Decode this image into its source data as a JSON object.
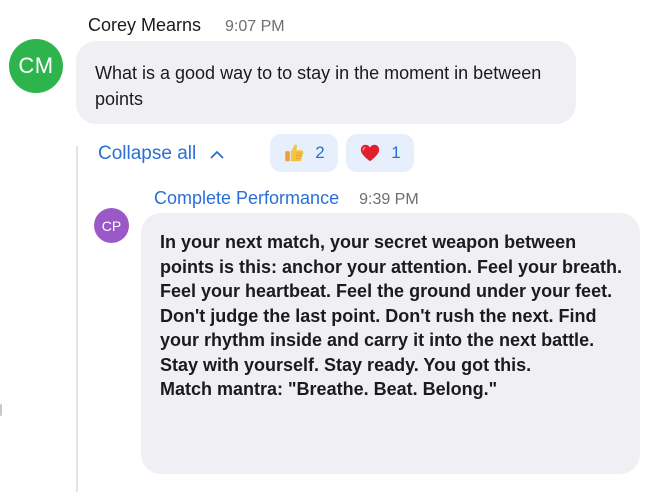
{
  "message": {
    "avatar_initials": "CM",
    "sender": "Corey Mearns",
    "time": "9:07 PM",
    "text": "What is a good way to to stay in the moment in between points",
    "avatar_color": "#2eb44c"
  },
  "thread": {
    "collapse_label": "Collapse all",
    "reactions": [
      {
        "emoji": "thumbs-up",
        "count": "2"
      },
      {
        "emoji": "red-heart",
        "count": "1"
      }
    ]
  },
  "reply": {
    "avatar_initials": "CP",
    "sender": "Complete Performance",
    "time": "9:39 PM",
    "body": "In your next match, your secret weapon between points is this: anchor your attention. Feel your breath. Feel your heartbeat. Feel the ground under your feet. Don't judge the last point. Don't rush the next. Find your rhythm inside and carry it into the next battle. Stay with yourself. Stay ready. You got this.",
    "mantra": "Match mantra: \"Breathe. Beat. Belong.\"",
    "avatar_color": "#9b59c8"
  },
  "colors": {
    "accent": "#2a6fd6",
    "bubble": "#f0f0f4",
    "reaction_bg": "#e6effb"
  }
}
